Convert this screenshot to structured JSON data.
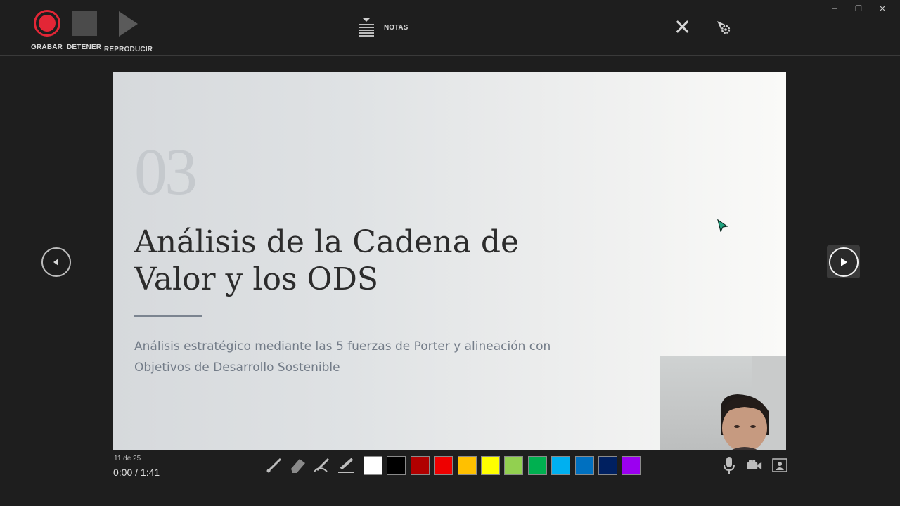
{
  "toolbar": {
    "record_label": "GRABAR",
    "stop_label": "DETENER",
    "play_label": "REPRODUCIR",
    "notes_label": "NOTAS"
  },
  "window_controls": {
    "minimize": "–",
    "restore": "❐",
    "close": "✕"
  },
  "slide": {
    "number": "03",
    "title": "Análisis de la Cadena de Valor y los ODS",
    "subtitle": "Análisis estratégico mediante las 5 fuerzas de Porter y alineación con Objetivos de Desarrollo Sostenible"
  },
  "footer": {
    "slide_counter": "11 de 25",
    "time": "0:00  /  1:41"
  },
  "ink_colors": [
    "#ffffff",
    "#000000",
    "#b00000",
    "#ee0000",
    "#ffc000",
    "#ffff00",
    "#92d050",
    "#00b050",
    "#00b0f0",
    "#0070c0",
    "#002060",
    "#9b00f0"
  ],
  "icons": {
    "record": "record-icon",
    "stop": "stop-icon",
    "play": "play-icon",
    "notes": "notes-icon",
    "close": "close-icon",
    "settings": "settings-icon",
    "prev": "arrow-left-icon",
    "next": "arrow-right-icon",
    "pen": "pen-icon",
    "eraser": "eraser-icon",
    "marker": "marker-icon",
    "highlighter": "highlighter-icon",
    "mic": "microphone-icon",
    "camera": "camera-icon",
    "camera_preview": "camera-preview-icon"
  }
}
